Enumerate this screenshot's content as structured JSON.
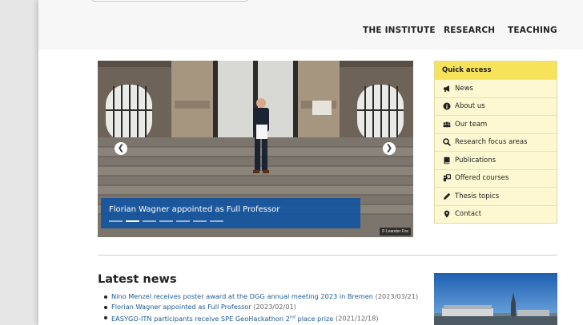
{
  "header": {
    "nav": [
      "THE INSTITUTE",
      "RESEARCH",
      "TEACHING"
    ]
  },
  "slider": {
    "caption": "Florian Wagner appointed as Full Professor",
    "credit": "© Leander Fox",
    "dot_count": 7,
    "active_dot": 1
  },
  "quick_access": {
    "title": "Quick access",
    "items": [
      {
        "label": "News",
        "icon": "bullhorn-icon"
      },
      {
        "label": "About us",
        "icon": "info-circle-icon"
      },
      {
        "label": "Our team",
        "icon": "users-icon"
      },
      {
        "label": "Research focus areas",
        "icon": "magnifier-icon"
      },
      {
        "label": "Publications",
        "icon": "book-icon"
      },
      {
        "label": "Offered courses",
        "icon": "chalkboard-teacher-icon"
      },
      {
        "label": "Thesis topics",
        "icon": "pencil-icon"
      },
      {
        "label": "Contact",
        "icon": "map-marker-icon"
      }
    ]
  },
  "news": {
    "title": "Latest news",
    "items": [
      {
        "text": "Nino Menzel receives poster award at the DGG annual meeting 2023 in Bremen",
        "date": "(2023/03/21)"
      },
      {
        "text": "Florian Wagner appointed as Full Professor",
        "date": "(2023/02/01)"
      },
      {
        "text_before": "EASYGO-ITN participants receive SPE GeoHackathon 2",
        "sup": "nd",
        "text_after": " place prize",
        "date": "(2021/12/18)"
      }
    ]
  }
}
